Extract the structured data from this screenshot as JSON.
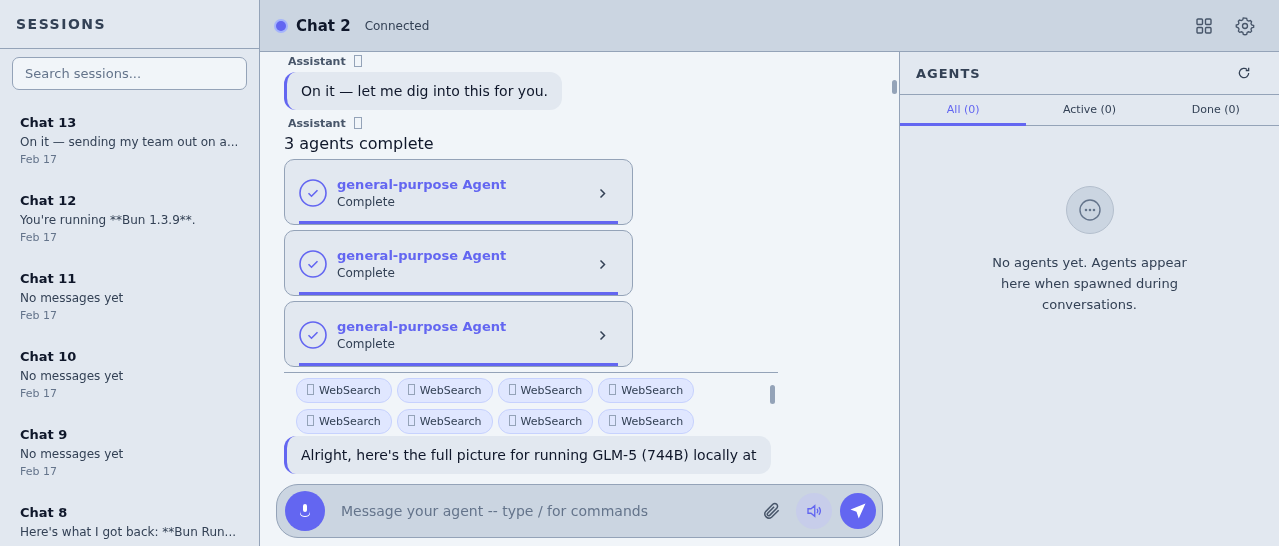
{
  "sidebar": {
    "title": "SESSIONS",
    "search": {
      "placeholder": "Search sessions..."
    },
    "sessions": [
      {
        "title": "Chat 13",
        "preview": "On it — sending my team out on a...",
        "date": "Feb 17"
      },
      {
        "title": "Chat 12",
        "preview": "You're running **Bun 1.3.9**.",
        "date": "Feb 17"
      },
      {
        "title": "Chat 11",
        "preview": "No messages yet",
        "date": "Feb 17"
      },
      {
        "title": "Chat 10",
        "preview": "No messages yet",
        "date": "Feb 17"
      },
      {
        "title": "Chat 9",
        "preview": "No messages yet",
        "date": "Feb 17"
      },
      {
        "title": "Chat 8",
        "preview": "Here's what I got back: **Bun Run..."
      }
    ]
  },
  "header": {
    "title": "Chat 2",
    "status": "Connected",
    "connected": true
  },
  "messages": [
    {
      "kind": "label",
      "text": "Assistant"
    },
    {
      "kind": "bubble",
      "text": "On it — let me dig into this for you."
    },
    {
      "kind": "label",
      "text": "Assistant"
    },
    {
      "kind": "agents",
      "title": "3 agents complete",
      "agents": [
        {
          "name": "general-purpose Agent",
          "status": "Complete",
          "level": 1
        },
        {
          "name": "general-purpose Agent",
          "status": "Complete",
          "level": 1
        },
        {
          "name": "general-purpose Agent",
          "status": "Complete",
          "level": 1
        }
      ],
      "tools": [
        "WebSearch",
        "WebSearch",
        "WebSearch",
        "WebSearch",
        "WebSearch",
        "WebSearch",
        "WebSearch",
        "WebSearch"
      ]
    },
    {
      "kind": "bubble",
      "text": "Alright, here's the full picture for running GLM-5 (744B) locally at"
    }
  ],
  "composer": {
    "placeholder": "Message your agent -- type / for commands"
  },
  "agents_panel": {
    "title": "AGENTS",
    "tabs": [
      {
        "label": "All (0)",
        "selected": true
      },
      {
        "label": "Active (0)",
        "selected": false
      },
      {
        "label": "Done (0)",
        "selected": false
      }
    ],
    "empty_text": "No agents yet. Agents appear here when spawned during conversations."
  }
}
